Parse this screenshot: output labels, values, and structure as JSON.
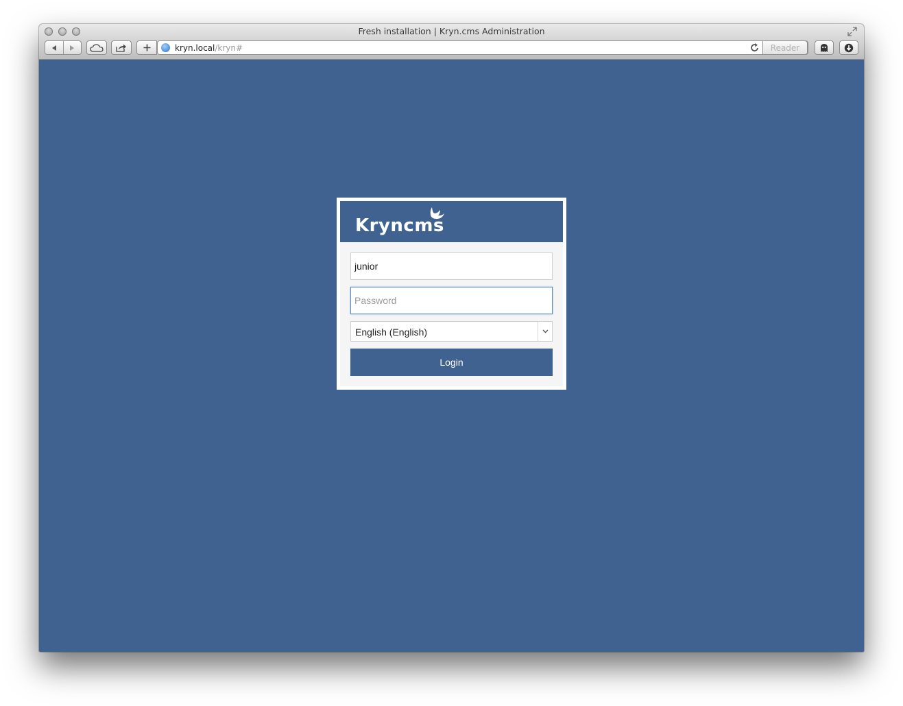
{
  "window": {
    "title": "Fresh installation | Kryn.cms Administration"
  },
  "toolbar": {
    "url_host": "kryn.local",
    "url_path": "/kryn#",
    "reader_label": "Reader",
    "icons": {
      "back": "back-arrow-icon",
      "forward": "forward-arrow-icon",
      "icloud": "cloud-icon",
      "share": "share-icon",
      "new_tab": "plus-icon",
      "reload": "reload-icon",
      "extensions": "ghostery-icon",
      "downloads": "download-icon"
    }
  },
  "login": {
    "logo_text": "Kryncms",
    "username_value": "junior",
    "password_placeholder": "Password",
    "language_selected": "English (English)",
    "login_label": "Login"
  },
  "colors": {
    "brand_blue": "#406291",
    "panel_bg": "#f5f5f5"
  }
}
